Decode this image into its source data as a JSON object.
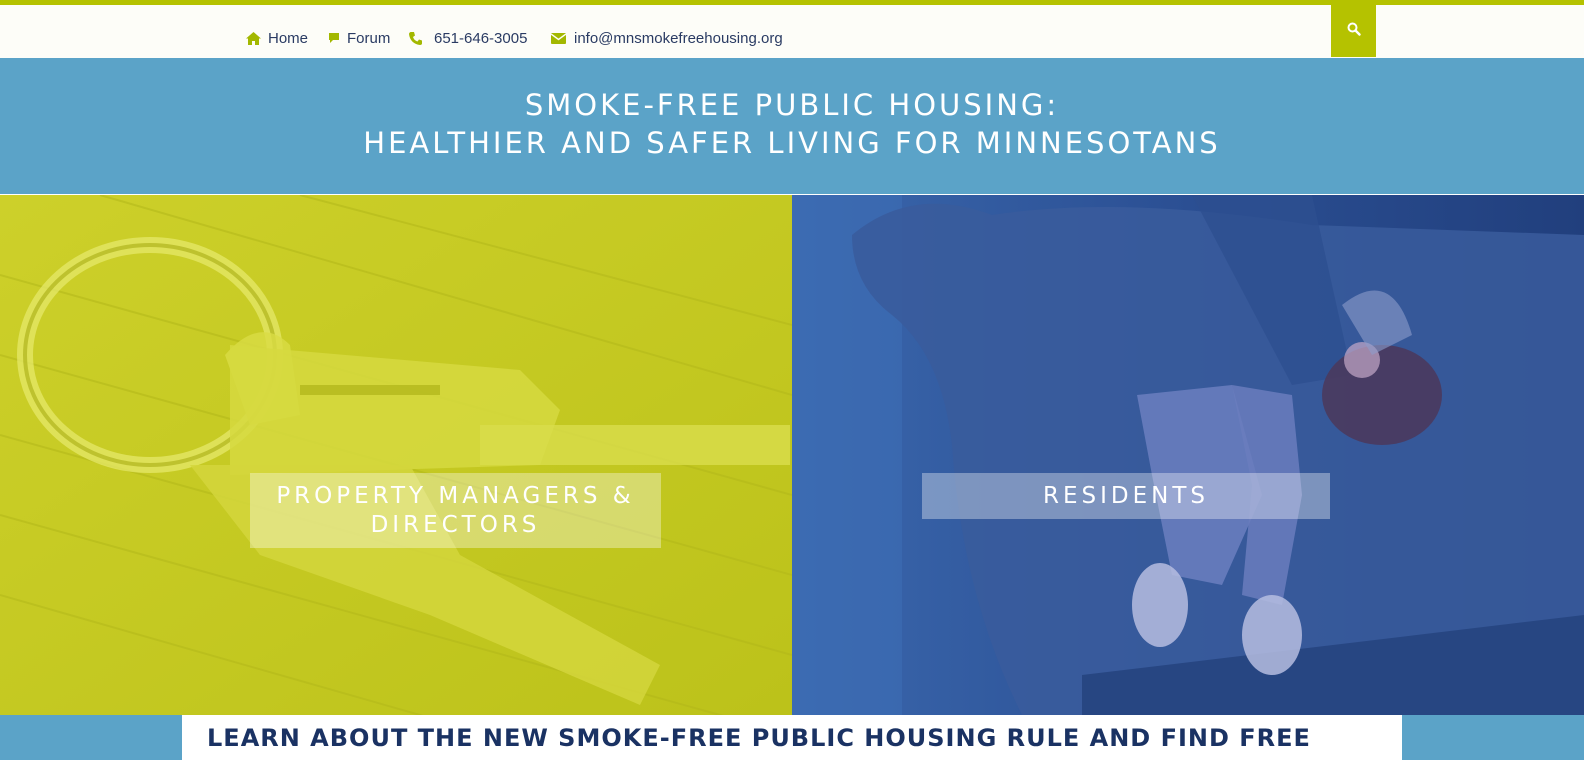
{
  "colors": {
    "accent": "#b5c200",
    "header_blue": "#5ba3c8",
    "left_panel": "#c4c91f",
    "right_panel": "#2a4a88",
    "navy_text": "#1a3263"
  },
  "nav": {
    "home": {
      "icon": "home-icon",
      "label": "Home"
    },
    "forum": {
      "icon": "chat-bubble-icon",
      "label": "Forum"
    },
    "phone": {
      "icon": "phone-icon",
      "label": "651-646-3005"
    },
    "email": {
      "icon": "envelope-icon",
      "label": "info@mnsmokefreehousing.org"
    },
    "search": {
      "icon": "search-icon"
    }
  },
  "hero": {
    "line1": "SMOKE-FREE PUBLIC HOUSING:",
    "line2": "HEALTHIER AND SAFER LIVING FOR MINNESOTANS"
  },
  "panels": {
    "left": {
      "label_line1": "PROPERTY MANAGERS &",
      "label_line2": "DIRECTORS",
      "image": "keys-on-wood-floor"
    },
    "right": {
      "label": "RESIDENTS",
      "image": "child-on-couch-with-puppy"
    }
  },
  "banner": {
    "text": "LEARN ABOUT THE NEW SMOKE-FREE PUBLIC HOUSING RULE AND FIND FREE"
  }
}
